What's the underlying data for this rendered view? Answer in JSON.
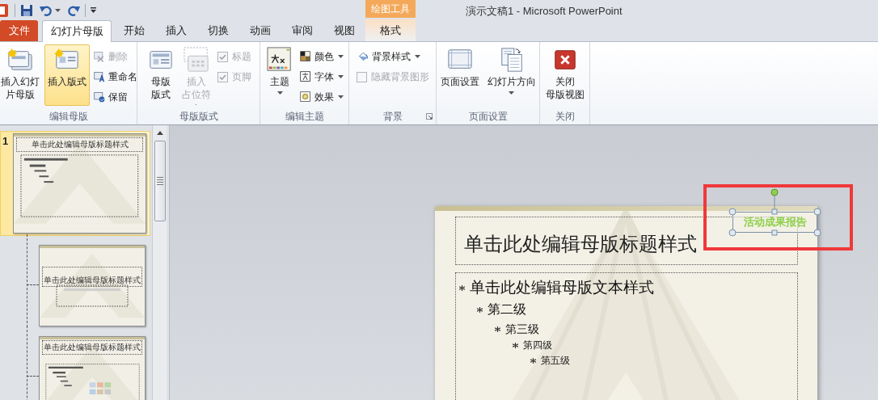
{
  "window": {
    "title": "演示文稿1  -  Microsoft PowerPoint"
  },
  "contextual_tab_group": {
    "label": "绘图工具",
    "tabs": [
      {
        "label": "格式",
        "selected": false
      }
    ]
  },
  "file_tab": {
    "label": "文件"
  },
  "tabs": [
    {
      "label": "幻灯片母版",
      "selected": true
    },
    {
      "label": "开始",
      "selected": false
    },
    {
      "label": "插入",
      "selected": false
    },
    {
      "label": "切换",
      "selected": false
    },
    {
      "label": "动画",
      "selected": false
    },
    {
      "label": "审阅",
      "selected": false
    },
    {
      "label": "视图",
      "selected": false
    }
  ],
  "ribbon": {
    "groups": [
      {
        "label": "编辑母版",
        "launcher": false,
        "items": [
          {
            "kind": "large",
            "label_lines": [
              "插入幻灯",
              "片母版"
            ],
            "disabled": false,
            "dropdown": false,
            "highlighted": false
          },
          {
            "kind": "large",
            "label_lines": [
              "插入版式"
            ],
            "disabled": false,
            "dropdown": false,
            "highlighted": true
          },
          {
            "kind": "small",
            "label": "删除",
            "disabled": true,
            "dropdown": false
          },
          {
            "kind": "small",
            "label": "重命名",
            "disabled": false,
            "dropdown": false
          },
          {
            "kind": "small",
            "label": "保留",
            "disabled": false,
            "dropdown": false
          }
        ]
      },
      {
        "label": "母版版式",
        "launcher": false,
        "items": [
          {
            "kind": "large",
            "label_lines": [
              "母版",
              "版式"
            ],
            "disabled": false,
            "dropdown": false,
            "highlighted": false
          },
          {
            "kind": "large",
            "label_lines": [
              "插入",
              "占位符"
            ],
            "disabled": true,
            "dropdown": true,
            "highlighted": false
          },
          {
            "kind": "check",
            "label": "标题",
            "disabled": true,
            "checked": true
          },
          {
            "kind": "check",
            "label": "页脚",
            "disabled": true,
            "checked": true
          }
        ]
      },
      {
        "label": "编辑主题",
        "launcher": false,
        "items": [
          {
            "kind": "large",
            "label_lines": [
              "主题"
            ],
            "disabled": false,
            "dropdown": true,
            "highlighted": false
          },
          {
            "kind": "small",
            "label": "颜色",
            "disabled": false,
            "dropdown": true
          },
          {
            "kind": "small",
            "label": "字体",
            "disabled": false,
            "dropdown": true
          },
          {
            "kind": "small",
            "label": "效果",
            "disabled": false,
            "dropdown": true
          }
        ]
      },
      {
        "label": "背景",
        "launcher": true,
        "items": [
          {
            "kind": "small",
            "label": "背景样式",
            "disabled": false,
            "dropdown": true
          },
          {
            "kind": "check",
            "label": "隐藏背景图形",
            "disabled": true,
            "checked": false
          }
        ]
      },
      {
        "label": "页面设置",
        "launcher": false,
        "items": [
          {
            "kind": "large",
            "label_lines": [
              "页面设置"
            ],
            "disabled": false,
            "dropdown": false,
            "highlighted": false
          },
          {
            "kind": "large",
            "label_lines": [
              "幻灯片方向"
            ],
            "disabled": false,
            "dropdown": true,
            "highlighted": false
          }
        ]
      },
      {
        "label": "关闭",
        "launcher": false,
        "items": [
          {
            "kind": "large",
            "label_lines": [
              "关闭",
              "母版视图"
            ],
            "disabled": false,
            "dropdown": false,
            "highlighted": false
          }
        ]
      }
    ]
  },
  "slide_panel": {
    "slides": [
      {
        "number": "1",
        "selected": true,
        "title": "单击此处编辑母版标题样式",
        "children": [
          {
            "kind": "title_layout",
            "selected": false,
            "title": "单击此处编辑母版标题样式"
          },
          {
            "kind": "content_layout",
            "selected": false,
            "title": "单击此处编辑母版标题样式"
          }
        ]
      }
    ]
  },
  "slide": {
    "title_placeholder": "单击此处编辑母版标题样式",
    "body_levels": [
      {
        "text": "单击此处编辑母版文本样式",
        "children": [
          {
            "text": "第二级",
            "children": [
              {
                "text": "第三级",
                "children": [
                  {
                    "text": "第四级",
                    "children": [
                      {
                        "text": "第五级"
                      }
                    ]
                  }
                ]
              }
            ]
          }
        ]
      }
    ],
    "text_box": {
      "text": "活动成果报告",
      "selected": true
    }
  }
}
